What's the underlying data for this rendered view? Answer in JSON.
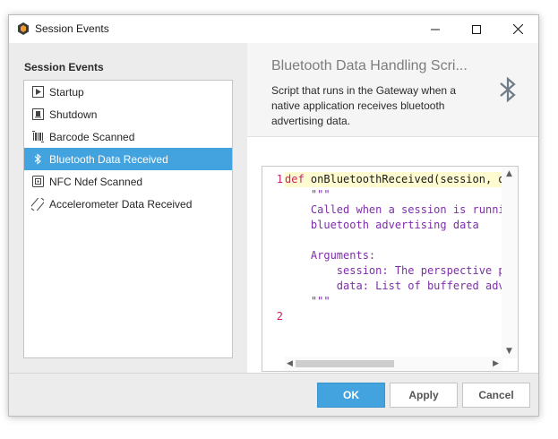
{
  "window": {
    "title": "Session Events"
  },
  "sidebar": {
    "title": "Session Events",
    "items": [
      {
        "label": "Startup",
        "icon": "startup-icon",
        "selected": false
      },
      {
        "label": "Shutdown",
        "icon": "shutdown-icon",
        "selected": false
      },
      {
        "label": "Barcode Scanned",
        "icon": "barcode-icon",
        "selected": false
      },
      {
        "label": "Bluetooth Data Received",
        "icon": "bluetooth-icon",
        "selected": true
      },
      {
        "label": "NFC Ndef Scanned",
        "icon": "nfc-icon",
        "selected": false
      },
      {
        "label": "Accelerometer Data Received",
        "icon": "accelerometer-icon",
        "selected": false
      }
    ]
  },
  "detail": {
    "title": "Bluetooth Data Handling Scri...",
    "description": "Script that runs in the Gateway when a native application receives bluetooth advertising data.",
    "icon": "bluetooth-icon"
  },
  "editor": {
    "line_numbers": [
      "1",
      "2"
    ],
    "lines": [
      {
        "keyword": "def",
        "text": " onBluetoothReceived(session, da"
      },
      {
        "keyword": "",
        "text": "    \"\"\""
      },
      {
        "keyword": "",
        "text": "    Called when a session is runnin"
      },
      {
        "keyword": "",
        "text": "    bluetooth advertising data"
      },
      {
        "keyword": "",
        "text": ""
      },
      {
        "keyword": "",
        "text": "    Arguments:"
      },
      {
        "keyword": "",
        "text": "        session: The perspective pr"
      },
      {
        "keyword": "",
        "text": "        data: List of buffered adve"
      },
      {
        "keyword": "",
        "text": "    \"\"\""
      }
    ]
  },
  "buttons": {
    "ok": "OK",
    "apply": "Apply",
    "cancel": "Cancel"
  },
  "colors": {
    "accent": "#43a3df",
    "keyword": "#c42266",
    "docstring": "#7d2ea8",
    "line_number": "#c42266"
  }
}
